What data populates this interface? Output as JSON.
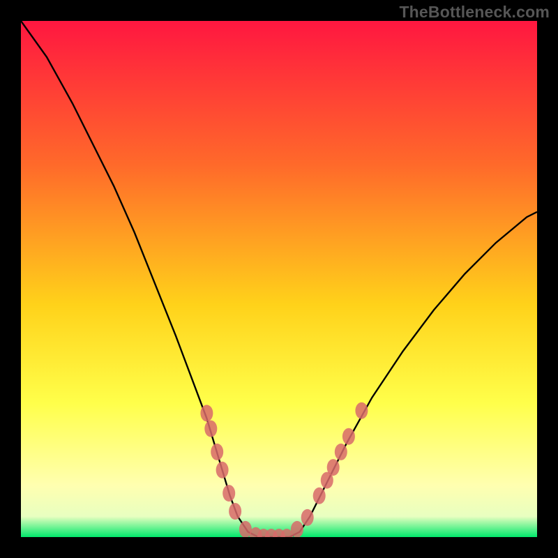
{
  "watermark": "TheBottleneck.com",
  "colors": {
    "gradient_top": "#ff1740",
    "gradient_mid1": "#ff6a2a",
    "gradient_mid2": "#ffd21a",
    "gradient_mid3": "#ffff4a",
    "gradient_mid4": "#ffffb0",
    "gradient_bottom": "#00e86b",
    "curve": "#000000",
    "dot": "#d86a6a",
    "frame": "#000000"
  },
  "chart_data": {
    "type": "line",
    "title": "",
    "xlabel": "",
    "ylabel": "",
    "xlim": [
      0,
      100
    ],
    "ylim": [
      0,
      100
    ],
    "grid": false,
    "series": [
      {
        "name": "bottleneck-curve",
        "x": [
          0,
          5,
          10,
          14,
          18,
          22,
          26,
          30,
          33,
          36,
          39,
          40.5,
          42,
          44,
          46,
          48,
          50,
          52,
          54,
          56,
          59,
          63,
          68,
          74,
          80,
          86,
          92,
          98,
          100
        ],
        "y": [
          100,
          93,
          84,
          76,
          68,
          59,
          49,
          39,
          31,
          23,
          13,
          8,
          4,
          1,
          0,
          0,
          0,
          0,
          1,
          4,
          10,
          18,
          27,
          36,
          44,
          51,
          57,
          62,
          63
        ]
      }
    ],
    "markers": [
      {
        "x": 36.0,
        "y": 24.0
      },
      {
        "x": 36.8,
        "y": 21.0
      },
      {
        "x": 38.0,
        "y": 16.5
      },
      {
        "x": 39.0,
        "y": 13.0
      },
      {
        "x": 40.3,
        "y": 8.5
      },
      {
        "x": 41.5,
        "y": 5.0
      },
      {
        "x": 43.5,
        "y": 1.5
      },
      {
        "x": 45.5,
        "y": 0.3
      },
      {
        "x": 47.0,
        "y": 0.0
      },
      {
        "x": 48.5,
        "y": 0.0
      },
      {
        "x": 50.0,
        "y": 0.0
      },
      {
        "x": 51.5,
        "y": 0.0
      },
      {
        "x": 53.5,
        "y": 1.5
      },
      {
        "x": 55.5,
        "y": 3.8
      },
      {
        "x": 57.8,
        "y": 8.0
      },
      {
        "x": 59.3,
        "y": 11.0
      },
      {
        "x": 60.5,
        "y": 13.5
      },
      {
        "x": 62.0,
        "y": 16.5
      },
      {
        "x": 63.5,
        "y": 19.5
      },
      {
        "x": 66.0,
        "y": 24.5
      }
    ]
  }
}
